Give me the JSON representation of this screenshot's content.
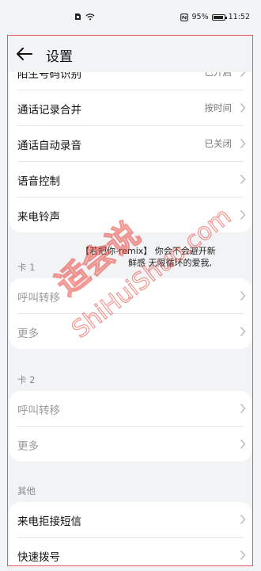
{
  "status_bar": {
    "notification_icons": [
      "sim-icon",
      "wifi-icon"
    ],
    "nfc_icon": "nfc-icon",
    "battery_percent": "95%",
    "battery_level": 0.95,
    "time": "11:52"
  },
  "header": {
    "title": "设置",
    "back_icon": "back-arrow-icon"
  },
  "general_rows": [
    {
      "label": "陌生号码识别",
      "value": "已开启"
    },
    {
      "label": "通话记录合并",
      "value": "按时间"
    },
    {
      "label": "通话自动录音",
      "value": "已关闭"
    },
    {
      "label": "语音控制",
      "value": ""
    },
    {
      "label": "来电铃声",
      "value": ""
    }
  ],
  "now_playing": {
    "line1": "【若把你-remix】 你会不会避开新",
    "line2": "鲜感 无限循环的爱我,"
  },
  "card1": {
    "title": "卡 1",
    "rows": [
      {
        "label": "呼叫转移"
      },
      {
        "label": "更多"
      }
    ]
  },
  "card2": {
    "title": "卡 2",
    "rows": [
      {
        "label": "呼叫转移"
      },
      {
        "label": "更多"
      }
    ]
  },
  "other": {
    "title": "其他",
    "rows": [
      {
        "label": "来电拒接短信"
      },
      {
        "label": "快速拨号"
      }
    ]
  },
  "watermark": {
    "cn": "适会说",
    "en": "ShiHuiShuo.com",
    "color": "#e8423a"
  },
  "colors": {
    "background": "#f1f3f5",
    "frame_border": "#e05a5a",
    "chevron": "#b8b8b8"
  }
}
